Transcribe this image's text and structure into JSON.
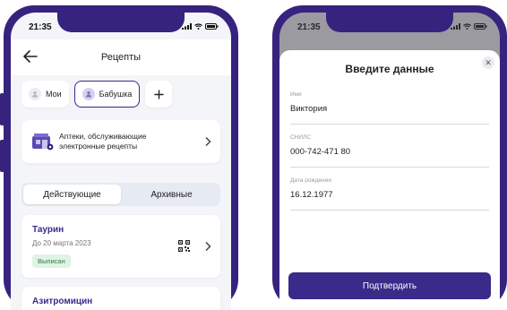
{
  "left_phone": {
    "status": {
      "time": "21:35"
    },
    "header": {
      "title": "Рецепты"
    },
    "chips": [
      {
        "label": "Мои",
        "avatar_color": "#e8e8ee"
      },
      {
        "label": "Бабушка",
        "avatar_color": "#c9c6ec"
      }
    ],
    "pharmacy_card": {
      "text": "Аптеки, обслуживающие электронные рецепты"
    },
    "tabs": {
      "active": "Действующие",
      "archive": "Архивные"
    },
    "prescriptions": [
      {
        "name": "Таурин",
        "date": "До 20 марта 2023",
        "status": "Выписан"
      },
      {
        "name": "Азитромицин"
      }
    ]
  },
  "right_phone": {
    "status": {
      "time": "21:35"
    },
    "modal": {
      "title": "Введите данные",
      "fields": [
        {
          "label": "Имя",
          "value": "Виктория"
        },
        {
          "label": "СНИЛС",
          "value": "000-742-471 80"
        },
        {
          "label": "Дата рождения",
          "value": "16.12.1977"
        }
      ],
      "confirm_label": "Подтвердить"
    }
  },
  "colors": {
    "accent": "#3a2a8a",
    "frame": "#36237e",
    "badge_bg": "#dff3e4",
    "badge_text": "#2f7a45"
  }
}
